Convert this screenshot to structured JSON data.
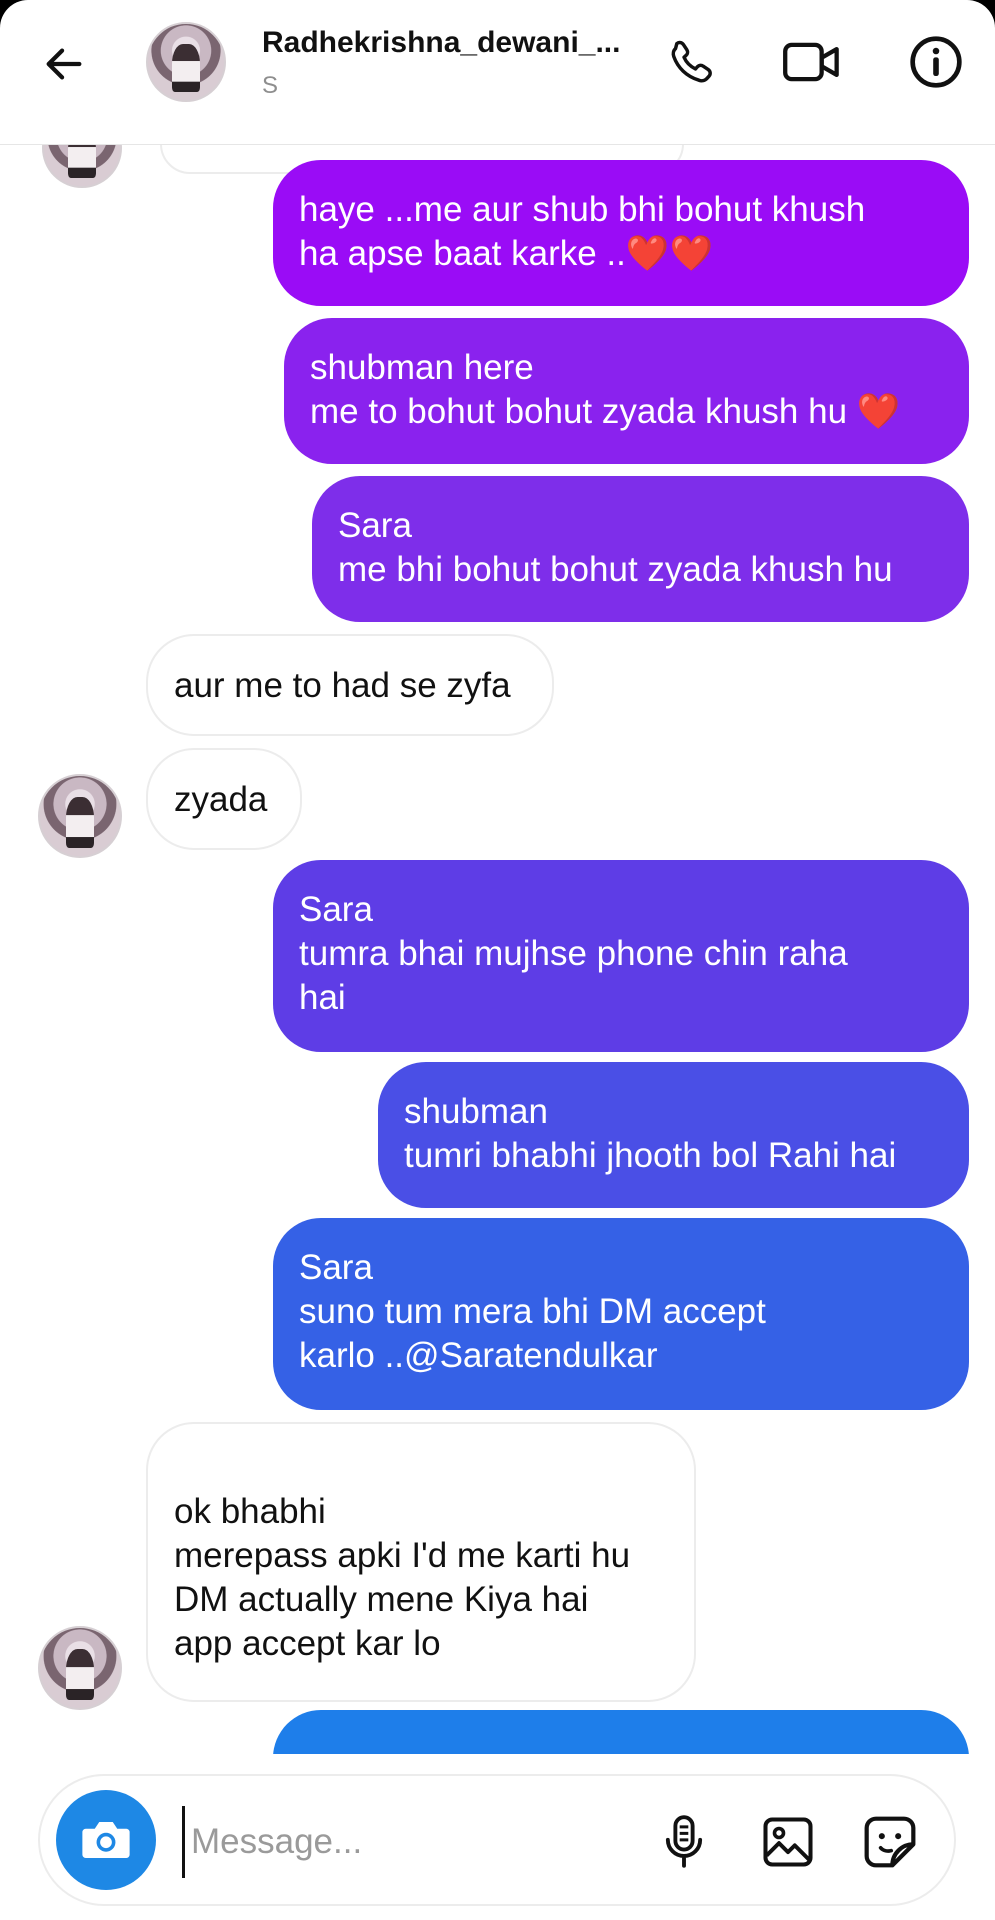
{
  "header": {
    "title": "Radhekrishna_dewani_...",
    "subtitle": "S"
  },
  "messages": [
    {
      "side": "out",
      "text": "haye ...me aur shub bhi bohut khush\nha apse baat karke ..❤️❤️"
    },
    {
      "side": "out",
      "text": "shubman here\nme to bohut bohut zyada khush hu ❤️"
    },
    {
      "side": "out",
      "text": "Sara\nme bhi bohut bohut zyada khush hu"
    },
    {
      "side": "in",
      "text": "aur me to had se zyfa"
    },
    {
      "side": "in",
      "text": "zyada"
    },
    {
      "side": "out",
      "text": "Sara\ntumra bhai mujhse phone chin raha\nhai"
    },
    {
      "side": "out",
      "text": "shubman\ntumri bhabhi jhooth bol Rahi hai"
    },
    {
      "side": "out",
      "text": "Sara\nsuno tum mera bhi DM accept\nkarlo ..@Saratendulkar"
    },
    {
      "side": "in",
      "text": "ok bhabhi\nmerepass apki I'd me karti hu\nDM actually mene Kiya hai\napp accept kar lo"
    }
  ],
  "composer": {
    "placeholder": "Message..."
  },
  "colors": {
    "bubble_1": "#9A0CF6",
    "bubble_2": "#8A22EE",
    "bubble_3": "#7E2EEA",
    "bubble_6": "#5E3DE6",
    "bubble_7": "#4A4FE6",
    "bubble_8": "#3561E6",
    "bubble_partial": "#1E7EEA",
    "camera_button": "#1E88E5"
  },
  "icons": [
    "back-arrow-icon",
    "phone-icon",
    "video-camera-icon",
    "info-icon",
    "camera-icon",
    "microphone-icon",
    "gallery-icon",
    "sticker-icon"
  ]
}
